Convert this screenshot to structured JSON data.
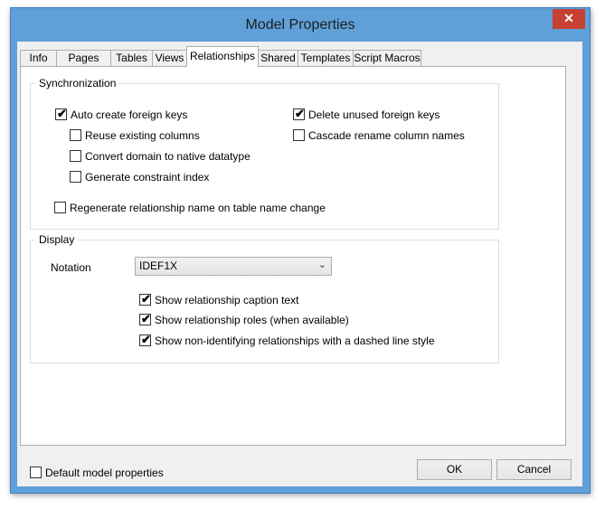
{
  "window": {
    "title": "Model Properties",
    "close_glyph": "✕"
  },
  "tabs": [
    {
      "label": "Info"
    },
    {
      "label": "Pages"
    },
    {
      "label": "Tables"
    },
    {
      "label": "Views"
    },
    {
      "label": "Relationships"
    },
    {
      "label": "Shared"
    },
    {
      "label": "Templates"
    },
    {
      "label": "Script Macros"
    }
  ],
  "active_tab": "Relationships",
  "sync": {
    "label": "Synchronization",
    "auto_create_fk": {
      "label": "Auto create foreign keys",
      "checked": true
    },
    "reuse_columns": {
      "label": "Reuse existing columns",
      "checked": false
    },
    "convert_domain": {
      "label": "Convert domain to native datatype",
      "checked": false
    },
    "constraint_index": {
      "label": "Generate constraint index",
      "checked": false
    },
    "delete_unused_fk": {
      "label": "Delete unused foreign keys",
      "checked": true
    },
    "cascade_rename": {
      "label": "Cascade rename column names",
      "checked": false
    },
    "regen_name": {
      "label": "Regenerate relationship name on table name change",
      "checked": false
    }
  },
  "display": {
    "label": "Display",
    "notation_label": "Notation",
    "notation_value": "IDEF1X",
    "show_caption": {
      "label": "Show relationship caption text",
      "checked": true
    },
    "show_roles": {
      "label": "Show relationship roles (when available)",
      "checked": true
    },
    "show_dashed": {
      "label": "Show non-identifying relationships with a dashed line style",
      "checked": true
    }
  },
  "footer": {
    "default_props": {
      "label": "Default model properties",
      "checked": false
    },
    "ok_label": "OK",
    "cancel_label": "Cancel"
  },
  "check_glyph": "✔",
  "dropdown_glyph": "⌄"
}
